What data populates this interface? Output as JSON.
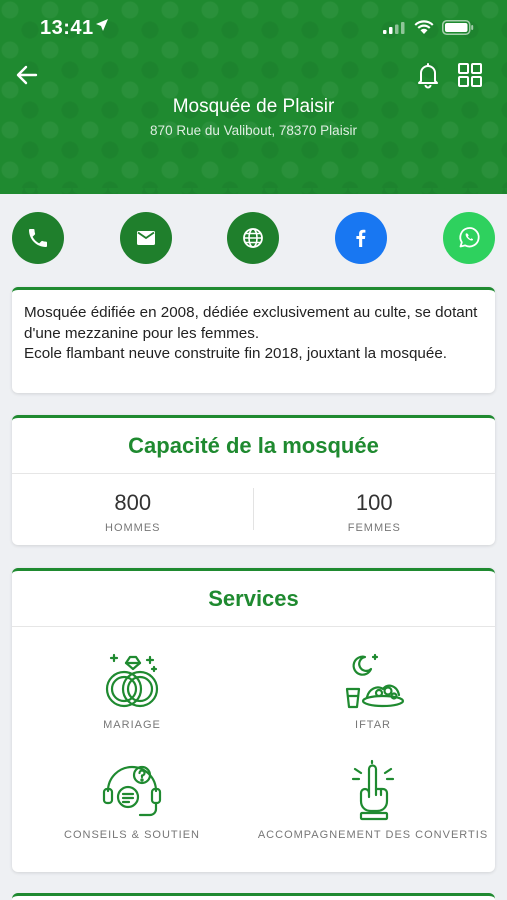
{
  "status": {
    "time": "13:41"
  },
  "header": {
    "name": "Mosquée de Plaisir",
    "address": "870 Rue du Valibout, 78370 Plaisir"
  },
  "contacts": [
    {
      "name": "phone",
      "color": "#1f7f2c"
    },
    {
      "name": "email",
      "color": "#1f7f2c"
    },
    {
      "name": "website",
      "color": "#1f7f2c"
    },
    {
      "name": "facebook",
      "color": "#1877f2"
    },
    {
      "name": "whatsapp",
      "color": "#2ed15e"
    }
  ],
  "description": "Mosquée édifiée en 2008, dédiée exclusivement au culte, se dotant d'une mezzanine pour les femmes.\nEcole flambant neuve construite fin 2018, jouxtant la mosquée.",
  "capacity": {
    "title": "Capacité de la mosquée",
    "men": {
      "value": "800",
      "label": "HOMMES"
    },
    "women": {
      "value": "100",
      "label": "FEMMES"
    }
  },
  "services": {
    "title": "Services",
    "items": [
      {
        "label": "MARIAGE",
        "icon": "rings-icon"
      },
      {
        "label": "IFTAR",
        "icon": "iftar-meal-icon"
      },
      {
        "label": "CONSEILS & SOUTIEN",
        "icon": "support-headset-icon"
      },
      {
        "label": "ACCOMPAGNEMENT DES CONVERTIS",
        "icon": "raised-finger-icon"
      }
    ]
  },
  "colors": {
    "accent": "#1f8a30",
    "facebook": "#1877f2",
    "whatsapp": "#2ed15e"
  }
}
